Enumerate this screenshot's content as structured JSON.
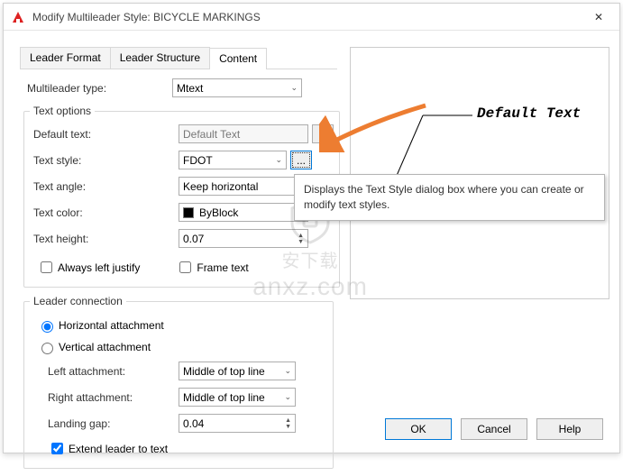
{
  "window": {
    "title": "Modify Multileader Style: BICYCLE MARKINGS"
  },
  "tabs": {
    "leader_format": "Leader Format",
    "leader_structure": "Leader Structure",
    "content": "Content"
  },
  "form": {
    "multileader_type_label": "Multileader type:",
    "multileader_type_value": "Mtext",
    "text_options_legend": "Text options",
    "default_text_label": "Default text:",
    "default_text_value": "Default Text",
    "text_style_label": "Text style:",
    "text_style_value": "FDOT",
    "text_angle_label": "Text angle:",
    "text_angle_value": "Keep horizontal",
    "text_color_label": "Text color:",
    "text_color_value": "ByBlock",
    "text_height_label": "Text height:",
    "text_height_value": "0.07",
    "always_left_label": "Always left justify",
    "frame_text_label": "Frame text",
    "leader_connection_legend": "Leader connection",
    "horizontal_attachment_label": "Horizontal attachment",
    "vertical_attachment_label": "Vertical attachment",
    "left_attachment_label": "Left attachment:",
    "left_attachment_value": "Middle of top line",
    "right_attachment_label": "Right attachment:",
    "right_attachment_value": "Middle of top line",
    "landing_gap_label": "Landing gap:",
    "landing_gap_value": "0.04",
    "extend_leader_label": "Extend leader to text"
  },
  "preview": {
    "sample_text": "Default Text"
  },
  "tooltip": {
    "text": "Displays the Text Style dialog box where you can create or modify text styles."
  },
  "buttons": {
    "ok": "OK",
    "cancel": "Cancel",
    "help": "Help"
  },
  "icons": {
    "ellipsis": "...",
    "close": "✕",
    "chev": "⌄"
  },
  "watermark": {
    "text": "anxz.com"
  }
}
